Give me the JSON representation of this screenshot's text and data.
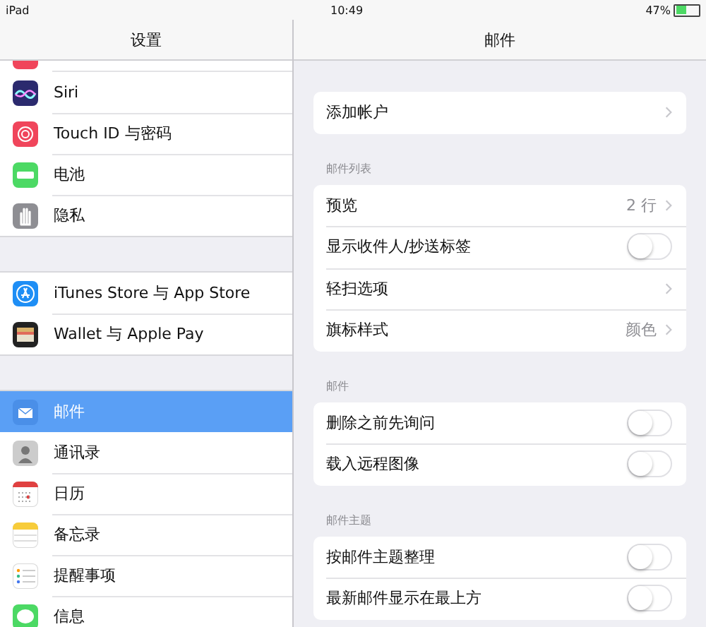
{
  "status_bar": {
    "device": "iPad",
    "time": "10:49",
    "battery": "47%"
  },
  "sidebar": {
    "title": "设置",
    "groups": [
      {
        "items": [
          {
            "label": "Siri",
            "selected": false
          },
          {
            "label": "Touch ID 与密码",
            "selected": false
          },
          {
            "label": "电池",
            "selected": false
          },
          {
            "label": "隐私",
            "selected": false
          }
        ]
      },
      {
        "items": [
          {
            "label": "iTunes Store 与 App Store",
            "selected": false
          },
          {
            "label": "Wallet 与 Apple Pay",
            "selected": false
          }
        ]
      },
      {
        "items": [
          {
            "label": "邮件",
            "selected": true
          },
          {
            "label": "通讯录",
            "selected": false
          },
          {
            "label": "日历",
            "selected": false
          },
          {
            "label": "备忘录",
            "selected": false
          },
          {
            "label": "提醒事项",
            "selected": false
          },
          {
            "label": "信息",
            "selected": false
          }
        ]
      }
    ]
  },
  "detail": {
    "title": "邮件",
    "sections": [
      {
        "rows": [
          {
            "kind": "link",
            "label": "添加帐户"
          }
        ]
      },
      {
        "header": "邮件列表",
        "rows": [
          {
            "kind": "link",
            "label": "预览",
            "value": "2 行"
          },
          {
            "kind": "toggle",
            "label": "显示收件人/抄送标签",
            "on": false
          },
          {
            "kind": "link",
            "label": "轻扫选项"
          },
          {
            "kind": "link",
            "label": "旗标样式",
            "value": "颜色"
          }
        ]
      },
      {
        "header": "邮件",
        "rows": [
          {
            "kind": "toggle",
            "label": "删除之前先询问",
            "on": false
          },
          {
            "kind": "toggle",
            "label": "载入远程图像",
            "on": false
          }
        ]
      },
      {
        "header": "邮件主题",
        "rows": [
          {
            "kind": "toggle",
            "label": "按邮件主题整理",
            "on": false
          },
          {
            "kind": "toggle",
            "label": "最新邮件显示在最上方",
            "on": false
          }
        ]
      }
    ]
  }
}
